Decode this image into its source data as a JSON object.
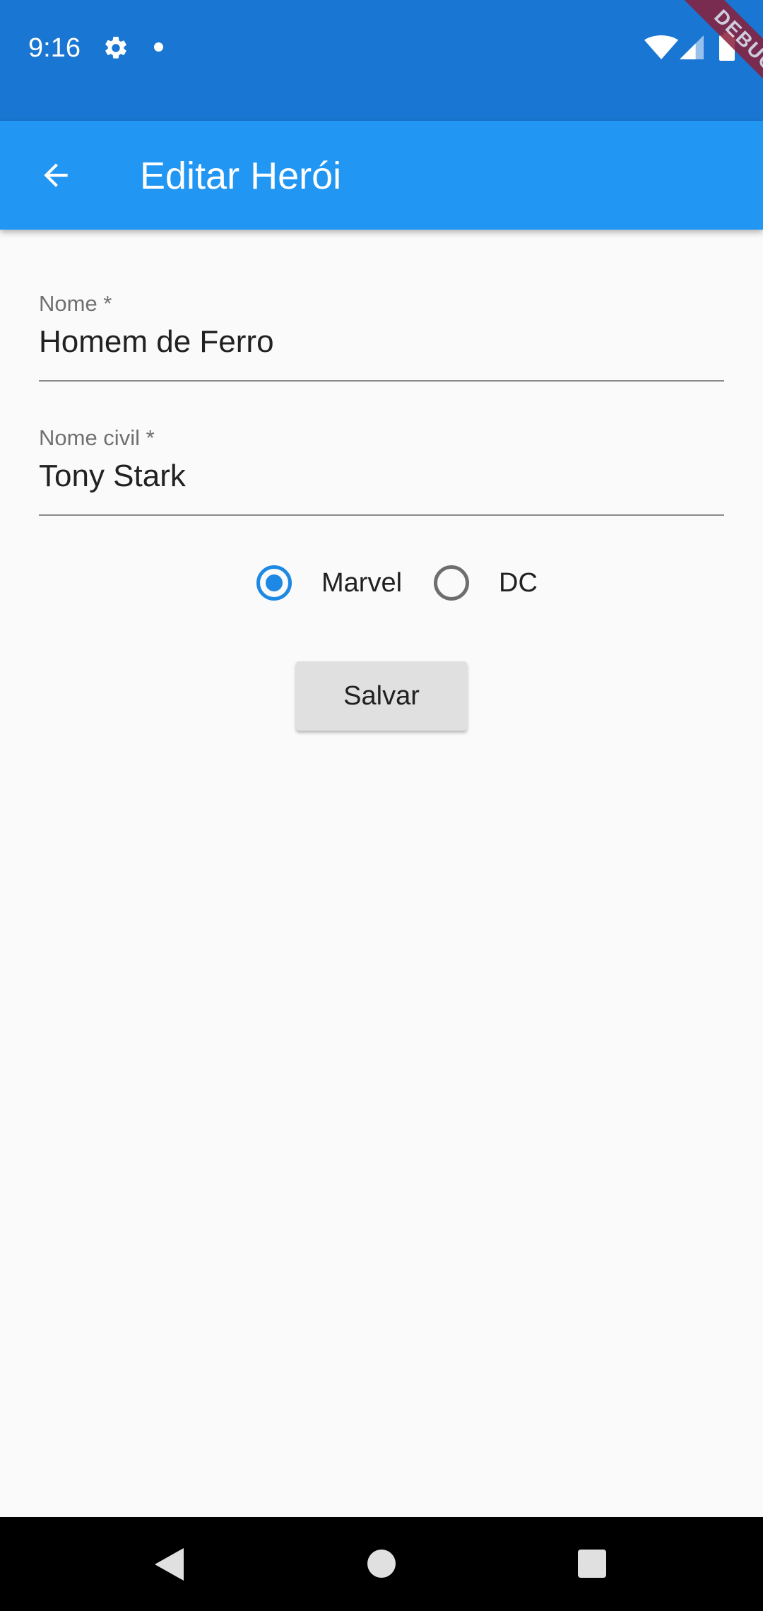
{
  "status_bar": {
    "time": "9:16",
    "icons": [
      "gear-icon",
      "notification-dot-icon",
      "wifi-icon",
      "signal-icon",
      "battery-icon"
    ]
  },
  "debug_banner": {
    "text": "DEBUG"
  },
  "app_bar": {
    "back_icon": "arrow-back-icon",
    "title": "Editar Herói",
    "color": "#2196f3"
  },
  "form": {
    "nome": {
      "label": "Nome *",
      "value": "Homem de Ferro"
    },
    "nome_civil": {
      "label": "Nome civil *",
      "value": "Tony Stark"
    },
    "publisher": {
      "options": [
        {
          "label": "Marvel",
          "selected": true
        },
        {
          "label": "DC",
          "selected": false
        }
      ],
      "accent_color": "#1e88e5"
    },
    "save_label": "Salvar"
  },
  "nav_bar": {
    "icons": [
      "nav-back-icon",
      "nav-home-icon",
      "nav-recents-icon"
    ]
  }
}
